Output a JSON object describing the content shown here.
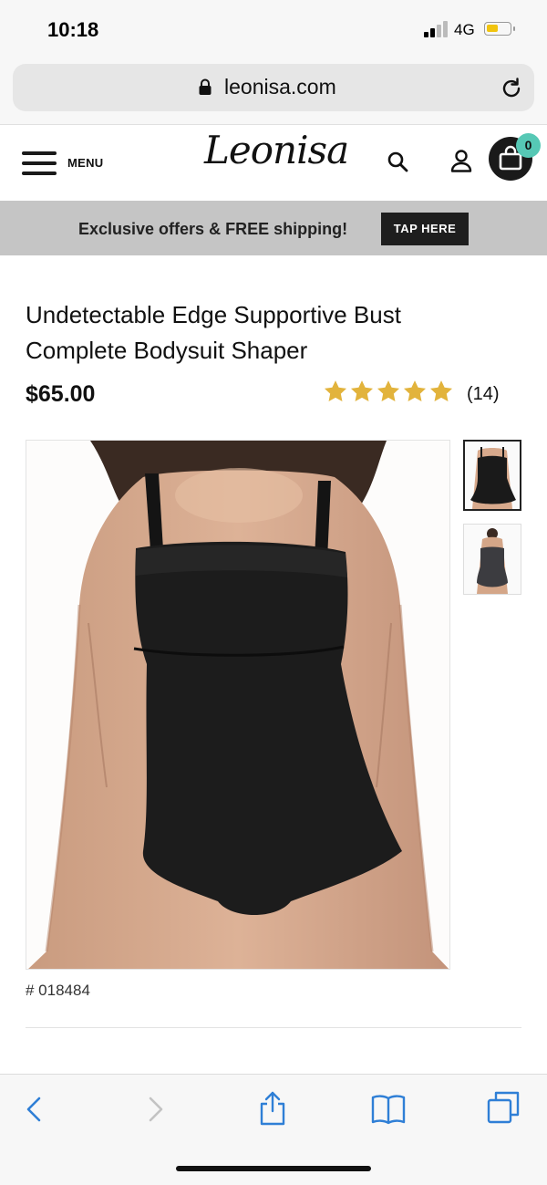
{
  "status_bar": {
    "time": "10:18",
    "network": "4G"
  },
  "browser": {
    "url": "leonisa.com"
  },
  "header": {
    "menu_label": "MENU",
    "logo_text": "Leonisa",
    "cart_count": "0"
  },
  "promo": {
    "text": "Exclusive offers & FREE shipping!",
    "button_label": "TAP HERE"
  },
  "product": {
    "title": "Undetectable Edge Supportive Bust Complete Bodysuit Shaper",
    "price": "$65.00",
    "rating": 5,
    "review_count": "(14)",
    "sku": "# 018484"
  },
  "colors": {
    "star": "#e2b33c",
    "cart_badge": "#56c8b5",
    "safari_blue": "#2f7fd6"
  }
}
